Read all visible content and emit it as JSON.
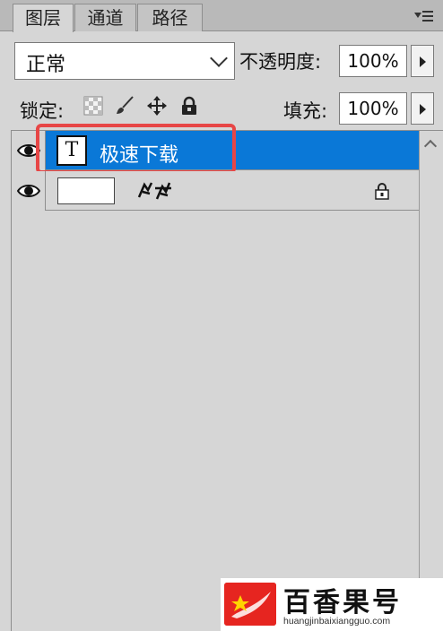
{
  "tabs": [
    {
      "label": "图层",
      "active": true
    },
    {
      "label": "通道",
      "active": false
    },
    {
      "label": "路径",
      "active": false
    }
  ],
  "blend_mode": {
    "value": "正常"
  },
  "opacity": {
    "label": "不透明度:",
    "value": "100%"
  },
  "lock": {
    "label": "锁定:",
    "icons": [
      "lock-transparent-pixels-icon",
      "lock-image-pixels-icon",
      "lock-position-icon",
      "lock-all-icon"
    ]
  },
  "fill": {
    "label": "填充:",
    "value": "100%"
  },
  "layers": [
    {
      "name": "极速下载",
      "type": "text",
      "thumb_glyph": "T",
      "selected": true,
      "visible": true
    },
    {
      "name": "",
      "type": "background",
      "selected": false,
      "visible": true,
      "locked": true
    }
  ],
  "watermark": {
    "title": "百香果号",
    "url": "huangjinbaixiangguo.com"
  },
  "colors": {
    "selection": "#0a78d7",
    "highlight": "#e74646",
    "panel_bg": "#d6d6d6",
    "watermark_red": "#e62520"
  }
}
